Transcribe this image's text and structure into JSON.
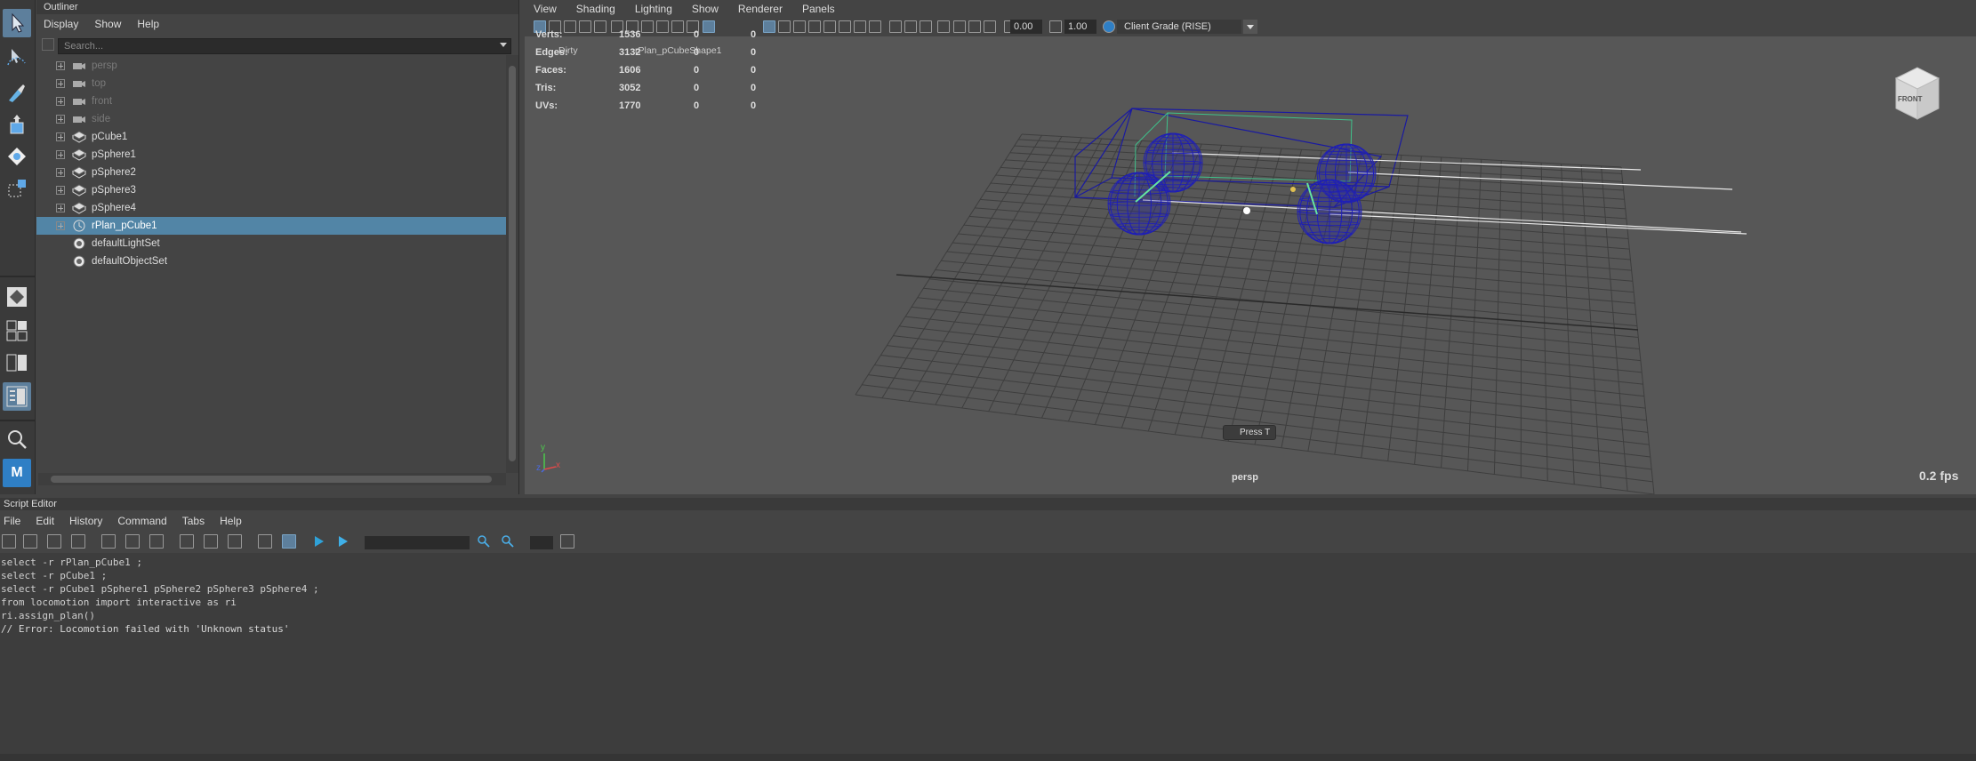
{
  "outliner": {
    "title": "Outliner",
    "menu": [
      "Display",
      "Show",
      "Help"
    ],
    "search_placeholder": "Search...",
    "items": [
      {
        "label": "persp",
        "type": "camera",
        "dim": true
      },
      {
        "label": "top",
        "type": "camera",
        "dim": true
      },
      {
        "label": "front",
        "type": "camera",
        "dim": true
      },
      {
        "label": "side",
        "type": "camera",
        "dim": true
      },
      {
        "label": "pCube1",
        "type": "mesh",
        "dim": false
      },
      {
        "label": "pSphere1",
        "type": "mesh",
        "dim": false
      },
      {
        "label": "pSphere2",
        "type": "mesh",
        "dim": false
      },
      {
        "label": "pSphere3",
        "type": "mesh",
        "dim": false
      },
      {
        "label": "pSphere4",
        "type": "mesh",
        "dim": false
      },
      {
        "label": "rPlan_pCube1",
        "type": "plan",
        "dim": false,
        "selected": true
      },
      {
        "label": "defaultLightSet",
        "type": "set",
        "dim": false
      },
      {
        "label": "defaultObjectSet",
        "type": "set",
        "dim": false
      }
    ]
  },
  "viewport": {
    "menu": [
      "View",
      "Shading",
      "Lighting",
      "Show",
      "Renderer",
      "Panels"
    ],
    "field1": "0.00",
    "field2": "1.00",
    "renderer": "Client Grade (RISE)",
    "heads_up": {
      "dirty": "Dirty",
      "shape": "rPlan_pCubeShape1",
      "rows": [
        {
          "label": "Verts:",
          "v1": "1536",
          "v2": "0",
          "v3": "0"
        },
        {
          "label": "Edges:",
          "v1": "3132",
          "v2": "0",
          "v3": "0"
        },
        {
          "label": "Faces:",
          "v1": "1606",
          "v2": "0",
          "v3": "0"
        },
        {
          "label": "Tris:",
          "v1": "3052",
          "v2": "0",
          "v3": "0"
        },
        {
          "label": "UVs:",
          "v1": "1770",
          "v2": "0",
          "v3": "0"
        }
      ]
    },
    "camera_label": "persp",
    "fps": "0.2 fps",
    "press_t": "Press T",
    "viewcube_label": "FRONT",
    "axis_y": "y",
    "axis_z": "z",
    "axis_x": "x"
  },
  "script_editor": {
    "title": "Script Editor",
    "menu": [
      "File",
      "Edit",
      "History",
      "Command",
      "Tabs",
      "Help"
    ],
    "history": [
      "select -r rPlan_pCube1 ;",
      "select -r pCube1 ;",
      "select -r pCube1 pSphere1 pSphere2 pSphere3 pSphere4 ;",
      "from locomotion import interactive as ri",
      "ri.assign_plan()",
      "// Error: Locomotion failed with 'Unknown status'"
    ]
  },
  "toolbox_logo": "M"
}
